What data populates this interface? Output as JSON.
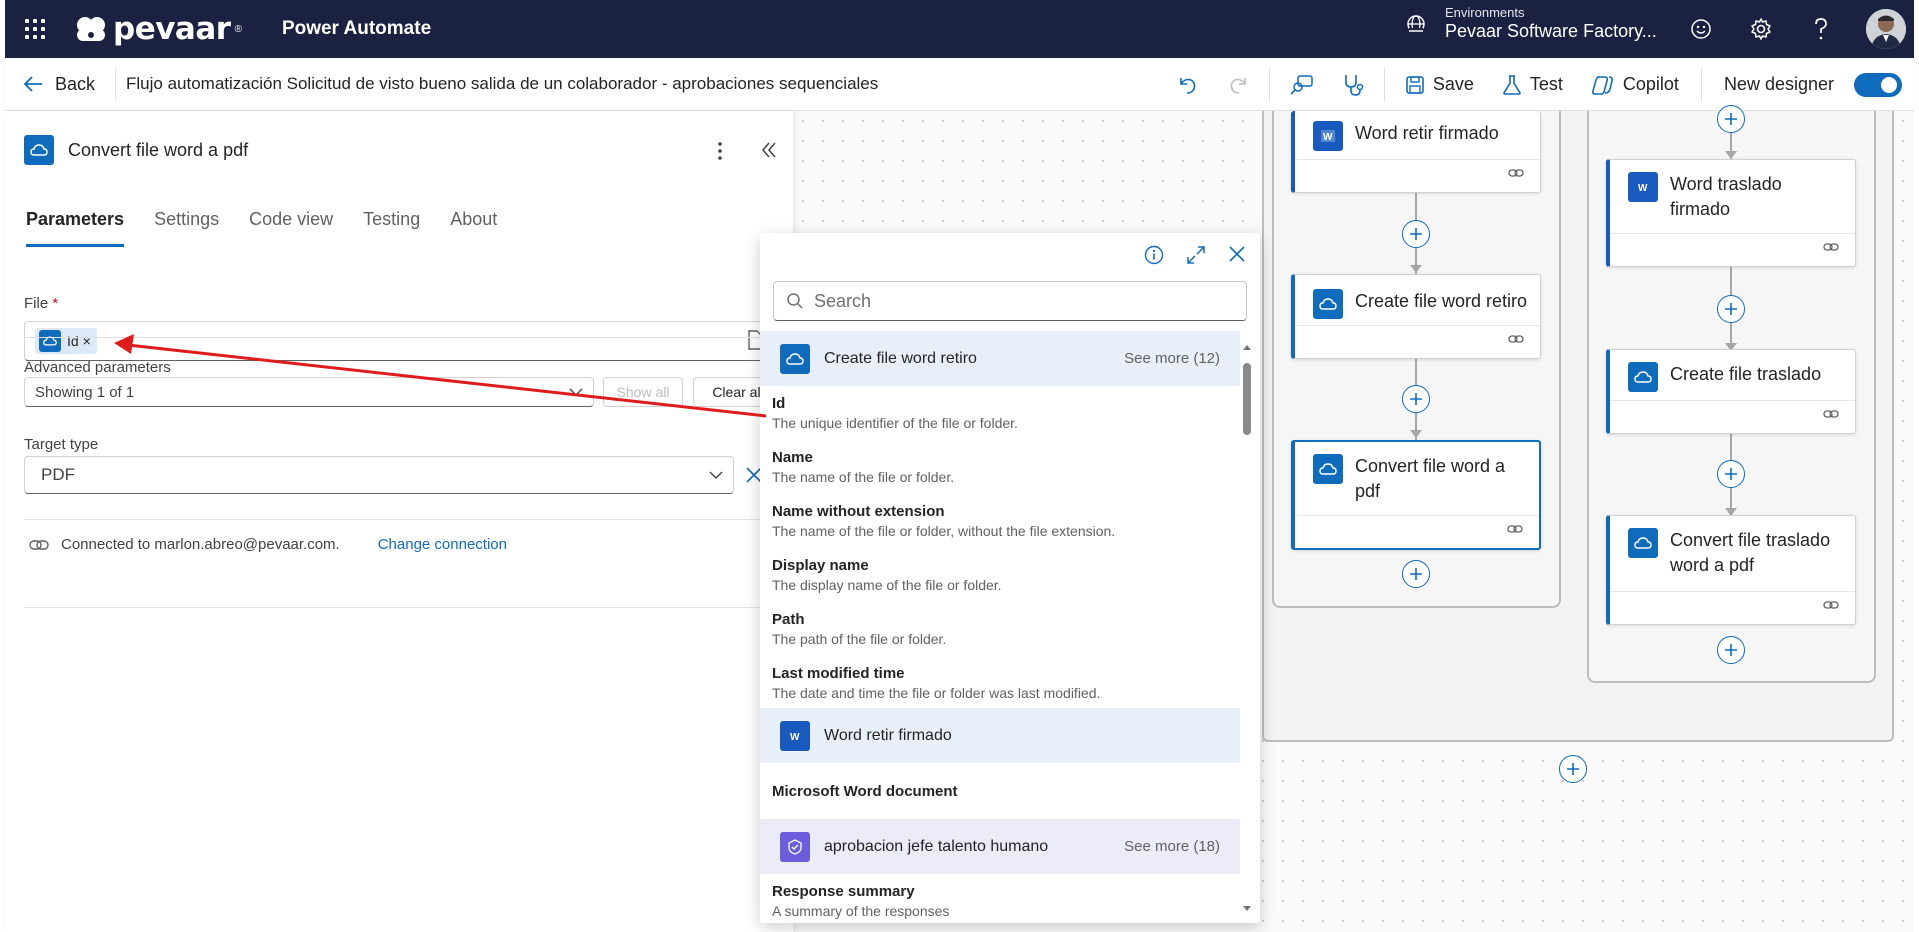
{
  "header": {
    "brand": "pevaar",
    "brand_mark": "®",
    "app_name": "Power Automate",
    "env_label": "Environments",
    "env_name": "Pevaar Software Factory..."
  },
  "cmdbar": {
    "back_label": "Back",
    "flow_title": "Flujo automatización Solicitud de visto bueno salida de un colaborador - aprobaciones sequenciales",
    "save_label": "Save",
    "test_label": "Test",
    "copilot_label": "Copilot",
    "new_designer_label": "New designer",
    "new_designer_on": true
  },
  "panel": {
    "title": "Convert file word a pdf",
    "tabs": [
      {
        "label": "Parameters",
        "active": true
      },
      {
        "label": "Settings",
        "active": false
      },
      {
        "label": "Code view",
        "active": false
      },
      {
        "label": "Testing",
        "active": false
      },
      {
        "label": "About",
        "active": false
      }
    ],
    "file_label": "File",
    "required_mark": "*",
    "file_token": "Id ×",
    "advanced_label": "Advanced parameters",
    "advanced_value": "Showing 1 of 1",
    "show_all": "Show all",
    "clear_all": "Clear all",
    "target_label": "Target type",
    "target_value": "PDF",
    "connected_text": "Connected to marlon.abreo@pevaar.com.",
    "change_connection": "Change connection"
  },
  "popup": {
    "search_placeholder": "Search",
    "groups": [
      {
        "title": "Create file word retiro",
        "see_more": "See more (12)"
      },
      {
        "title": "Word retir firmado",
        "see_more": ""
      },
      {
        "title": "aprobacion jefe talento humano",
        "see_more": "See more (18)"
      }
    ],
    "items_g1": [
      {
        "name": "Id",
        "desc": "The unique identifier of the file or folder."
      },
      {
        "name": "Name",
        "desc": "The name of the file or folder."
      },
      {
        "name": "Name without extension",
        "desc": "The name of the file or folder, without the file extension."
      },
      {
        "name": "Display name",
        "desc": "The display name of the file or folder."
      },
      {
        "name": "Path",
        "desc": "The path of the file or folder."
      },
      {
        "name": "Last modified time",
        "desc": "The date and time the file or folder was last modified."
      }
    ],
    "items_g2": [
      {
        "name": "Microsoft Word document",
        "desc": ""
      }
    ],
    "items_g3": [
      {
        "name": "Response summary",
        "desc": "A summary of the responses"
      }
    ]
  },
  "canvas": {
    "left_branch": [
      {
        "title": "Word retir firmado"
      },
      {
        "title": "Create file word retiro"
      },
      {
        "title": "Convert file word a pdf",
        "selected": true
      }
    ],
    "right_branch": [
      {
        "title": "Word traslado firmado"
      },
      {
        "title": "Create file traslado"
      },
      {
        "title": "Convert file traslado word a pdf"
      }
    ]
  },
  "colors": {
    "header_bg": "#1b2140",
    "accent": "#0f6cbd",
    "word": "#185abd",
    "approval": "#6b5ddc",
    "annotation_arrow": "#e01b1b"
  }
}
